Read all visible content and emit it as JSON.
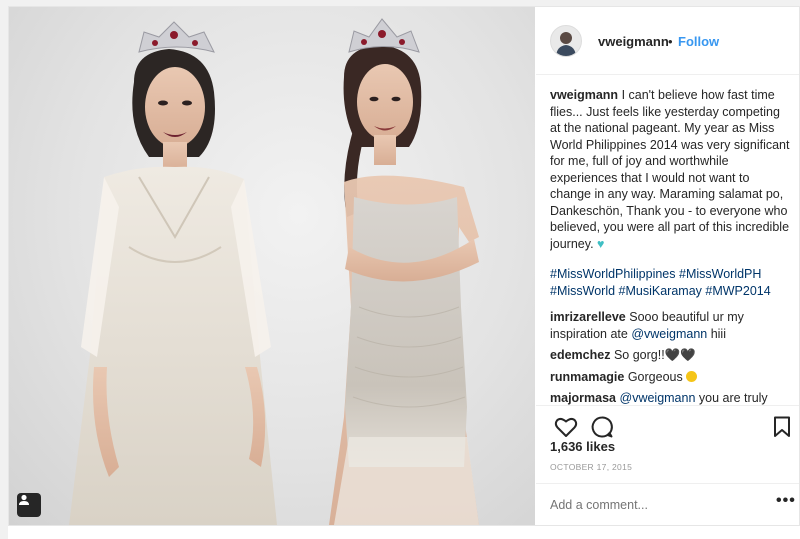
{
  "header": {
    "username": "vweigmann",
    "separator": "•",
    "follow_label": "Follow"
  },
  "caption": {
    "username": "vweigmann",
    "text": "I can't believe how fast time flies... Just feels like yesterday competing at the national pageant. My year as Miss World Philippines 2014 was very significant for me, full of joy and worthwhile experiences that I would not want to change in any way. Maraming salamat po, Dankeschön, Thank you - to everyone who believed, you were all part of this incredible journey.",
    "hashtags": "#MissWorldPhilippines #MissWorldPH #MissWorld #MusiKaramay #MWP2014"
  },
  "comments": [
    {
      "username": "imrizarelleve",
      "text": "Sooo beautiful ur my inspiration ate ",
      "mention": "@vweigmann",
      "after": " hiii"
    },
    {
      "username": "edemchez",
      "text": "So gorg!!🖤🖤"
    },
    {
      "username": "runmamagie",
      "text": "Gorgeous "
    },
    {
      "username": "majormasa",
      "mention": "@vweigmann",
      "text": " you are truly admirable. You're the only Miss World PH I"
    }
  ],
  "likes": "1,636 likes",
  "date": "OCTOBER 17, 2015",
  "add_comment_placeholder": "Add a comment...",
  "more_label": "•••",
  "icons": {
    "like": "heart-outline-icon",
    "comment": "comment-bubble-icon",
    "save": "bookmark-icon",
    "tagged_users": "user-tag-icon"
  },
  "colors": {
    "link": "#3897f0",
    "mention": "#003569",
    "muted": "#999999",
    "text": "#262626"
  }
}
